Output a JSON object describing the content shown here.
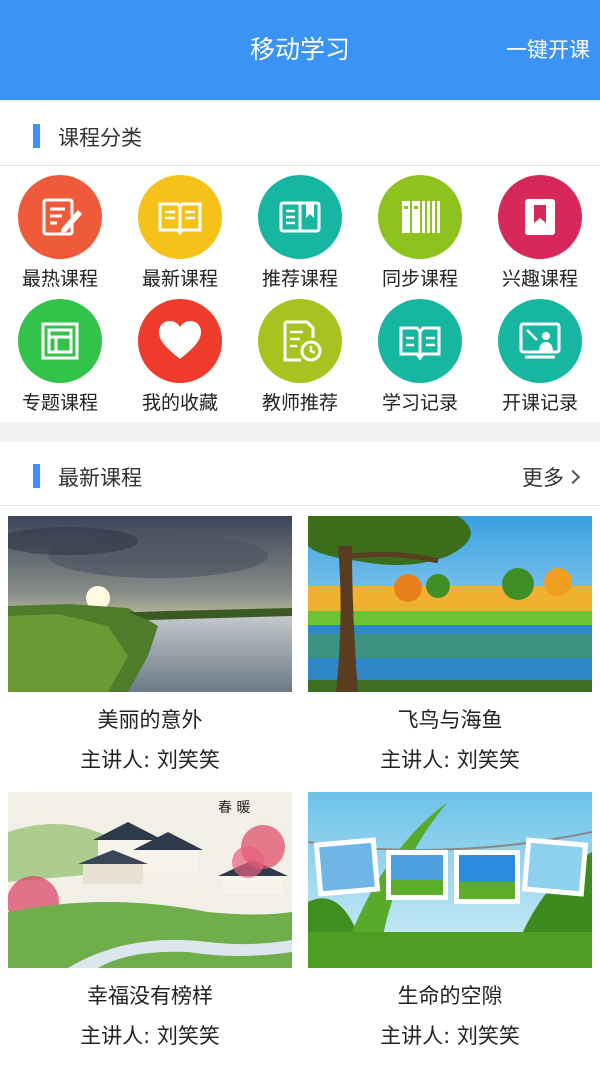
{
  "header": {
    "title": "移动学习",
    "action_label": "一键开课"
  },
  "category_section": {
    "label": "课程分类"
  },
  "categories": [
    {
      "name": "最热课程",
      "icon": "edit-document-icon",
      "color": "#ee5a3a"
    },
    {
      "name": "最新课程",
      "icon": "open-book-icon",
      "color": "#f6c21a"
    },
    {
      "name": "推荐课程",
      "icon": "bookmarked-book-icon",
      "color": "#17b6a0"
    },
    {
      "name": "同步课程",
      "icon": "bookshelf-icon",
      "color": "#8ec21f"
    },
    {
      "name": "兴趣课程",
      "icon": "bookmark-book-icon",
      "color": "#d6295a"
    },
    {
      "name": "专题课程",
      "icon": "layout-window-icon",
      "color": "#33c24a"
    },
    {
      "name": "我的收藏",
      "icon": "heart-icon",
      "color": "#ee3b2b"
    },
    {
      "name": "教师推荐",
      "icon": "document-clock-icon",
      "color": "#a6c31f"
    },
    {
      "name": "学习记录",
      "icon": "notebook-icon",
      "color": "#17b6a0"
    },
    {
      "name": "开课记录",
      "icon": "presentation-board-icon",
      "color": "#17b6a0"
    }
  ],
  "latest_section": {
    "label": "最新课程",
    "more_label": "更多"
  },
  "courses": [
    {
      "title": "美丽的意外",
      "teacher": "主讲人: 刘笑笑"
    },
    {
      "title": "飞鸟与海鱼",
      "teacher": "主讲人: 刘笑笑"
    },
    {
      "title": "幸福没有榜样",
      "teacher": "主讲人: 刘笑笑"
    },
    {
      "title": "生命的空隙",
      "teacher": "主讲人: 刘笑笑"
    }
  ]
}
